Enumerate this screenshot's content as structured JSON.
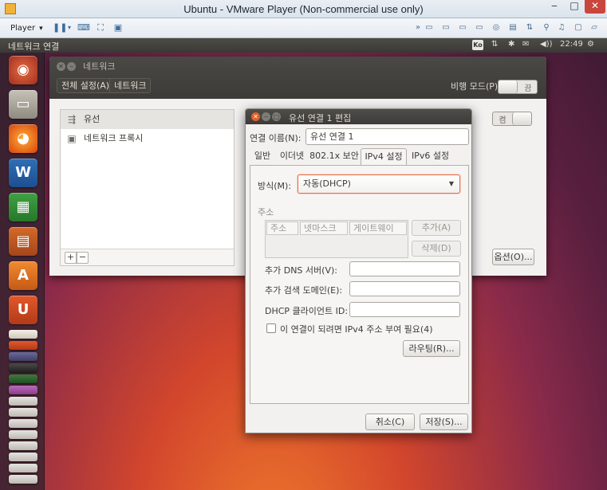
{
  "host": {
    "title": "Ubuntu - VMware Player (Non-commercial use only)",
    "player_menu": "Player"
  },
  "guest_panel": {
    "active_window": "네트워크 연결",
    "keyboard_indicator": "Ko",
    "clock": "22:49"
  },
  "network_window": {
    "title": "네트워크",
    "breadcrumb_all": "전체 설정(A)",
    "breadcrumb_network": "네트워크",
    "airplane_mode_label": "비행 모드(P)",
    "airplane_switch_state": "끔",
    "devices": [
      {
        "label": "유선",
        "icon": "wired-network-icon"
      },
      {
        "label": "네트워크 프록시",
        "icon": "proxy-icon"
      }
    ],
    "wired_switch_state": "켬",
    "add_label": "+",
    "remove_label": "−",
    "options_button": "옵션(O)..."
  },
  "edit_dialog": {
    "title": "유선 연결 1 편집",
    "connection_name_label": "연결 이름(N):",
    "connection_name_value": "유선 연결 1",
    "tabs": [
      "일반",
      "이더넷",
      "802.1x 보안",
      "IPv4 설정",
      "IPv6 설정"
    ],
    "active_tab": "IPv4 설정",
    "method_label": "방식(M):",
    "method_value": "자동(DHCP)",
    "addresses_label": "주소",
    "address_columns": [
      "주소",
      "넷마스크",
      "게이트웨이"
    ],
    "add_button": "추가(A)",
    "delete_button": "삭제(D)",
    "dns_label": "추가 DNS 서버(V):",
    "search_domains_label": "추가 검색 도메인(E):",
    "dhcp_client_id_label": "DHCP 클라이언트 ID:",
    "require_ipv4_label": "이 연결이 되려면 IPv4 주소 부여 필요(4)",
    "require_ipv4_checked": false,
    "routes_button": "라우팅(R)...",
    "cancel_button": "취소(C)",
    "save_button": "저장(S)..."
  },
  "colors": {
    "accent_focus": "#e8704a",
    "panel_dark": "#3c3b37",
    "window_bg": "#f2f1f0"
  }
}
